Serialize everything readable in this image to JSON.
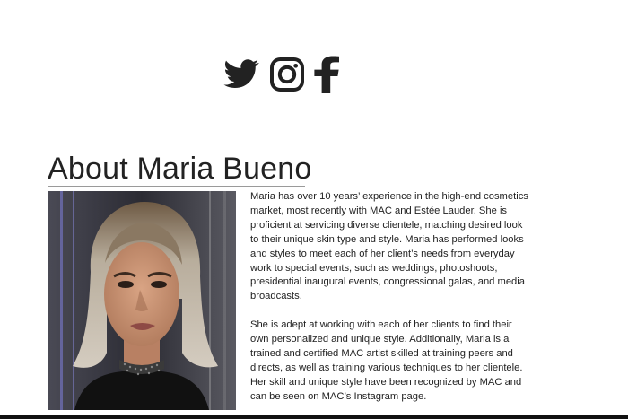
{
  "social": {
    "icons": [
      "twitter-icon",
      "instagram-icon",
      "facebook-icon"
    ],
    "color": "#222222"
  },
  "about": {
    "heading": "About Maria Bueno",
    "paragraphs": [
      "Maria has over 10 years’ experience in the high-end cosmetics market, most recently with MAC and Estée Lauder. She is proficient at servicing diverse clientele, matching desired look to their unique skin type and style. Maria has performed looks and styles to meet each of her client’s needs from everyday work to special events, such as weddings, photoshoots, presidential inaugural events, congressional galas, and media broadcasts.",
      "She is adept at working with each of her clients to find their own personalized and unique style. Additionally, Maria is a trained and certified MAC artist skilled at training peers and directs, as well as training various techniques to her clientele. Her skill and unique style have been recognized by MAC and can be seen on MAC’s Instagram page."
    ]
  }
}
